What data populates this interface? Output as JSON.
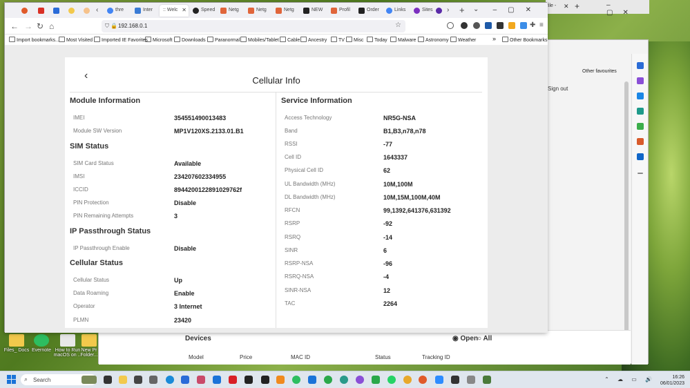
{
  "colors": {
    "accent": "#1a73d8",
    "card_bg": "#ffffff",
    "page_bg": "#ececec"
  },
  "browser": {
    "tabs": [
      "",
      "",
      "",
      "",
      "",
      "thre",
      "Inter",
      ":: Welc",
      "Speed",
      "Netg",
      "Netg",
      "Netg",
      "NEW",
      "Profil",
      "Order",
      "Links",
      "Sites",
      ""
    ],
    "url": "192.168.0.1",
    "bookmarks": [
      "Import bookmarks...",
      "Most Visited",
      "Imported IE Favorites",
      "Microsoft",
      "Downloads",
      "Paranormal",
      "Mobiles/Tablet",
      "Cable",
      "Ancestry",
      "TV",
      "Misc",
      "Today",
      "Malware",
      "Astronomy",
      "Weather",
      "Other Bookmarks"
    ]
  },
  "edge": {
    "tab_title": "file - ",
    "favourites": "Other favourites",
    "sign_out": "Sign out",
    "devices": {
      "title": "Devices",
      "filter_open": "Open",
      "filter_all": "All",
      "columns": [
        "Model",
        "Price",
        "MAC ID",
        "Status",
        "Tracking ID"
      ]
    }
  },
  "card": {
    "title": "Cellular Info",
    "left": {
      "module_title": "Module Information",
      "module": [
        {
          "label": "IMEI",
          "value": "354551490013483"
        },
        {
          "label": "Module SW Version",
          "value": "MP1V120XS.2133.01.B1"
        }
      ],
      "sim_title": "SIM Status",
      "sim": [
        {
          "label": "SIM Card Status",
          "value": "Available"
        },
        {
          "label": "IMSI",
          "value": "234207602334955"
        },
        {
          "label": "ICCID",
          "value": "8944200122891029762f"
        },
        {
          "label": "PIN Protection",
          "value": "Disable"
        },
        {
          "label": "PIN Remaining Attempts",
          "value": "3"
        }
      ],
      "ip_title": "IP Passthrough Status",
      "ip": [
        {
          "label": "IP Passthrough Enable",
          "value": "Disable"
        }
      ],
      "cell_title": "Cellular Status",
      "cell": [
        {
          "label": "Cellular Status",
          "value": "Up"
        },
        {
          "label": "Data Roaming",
          "value": "Enable"
        },
        {
          "label": "Operator",
          "value": "3 Internet"
        },
        {
          "label": "PLMN",
          "value": "23420"
        }
      ]
    },
    "right": {
      "service_title": "Service Information",
      "service": [
        {
          "label": "Access Technology",
          "value": "NR5G-NSA"
        },
        {
          "label": "Band",
          "value": "B1,B3,n78,n78"
        },
        {
          "label": "RSSI",
          "value": "-77"
        },
        {
          "label": "Cell ID",
          "value": "1643337"
        },
        {
          "label": "Physical Cell ID",
          "value": "62"
        },
        {
          "label": "UL Bandwidth (MHz)",
          "value": "10M,100M"
        },
        {
          "label": "DL Bandwidth (MHz)",
          "value": "10M,15M,100M,40M"
        },
        {
          "label": "RFCN",
          "value": "99,1392,641376,631392"
        },
        {
          "label": "RSRP",
          "value": "-92"
        },
        {
          "label": "RSRQ",
          "value": "-14"
        },
        {
          "label": "SINR",
          "value": "6"
        },
        {
          "label": "RSRP-NSA",
          "value": "-96"
        },
        {
          "label": "RSRQ-NSA",
          "value": "-4"
        },
        {
          "label": "SINR-NSA",
          "value": "12"
        },
        {
          "label": "TAC",
          "value": "2264"
        }
      ]
    }
  },
  "desktop_icons": [
    "Files_ Docs",
    "Evernote",
    "How to Run macOS on ...",
    "New Pr Folder..."
  ],
  "taskbar": {
    "search": "Search",
    "time": "16:26",
    "date": "06/01/2023"
  }
}
